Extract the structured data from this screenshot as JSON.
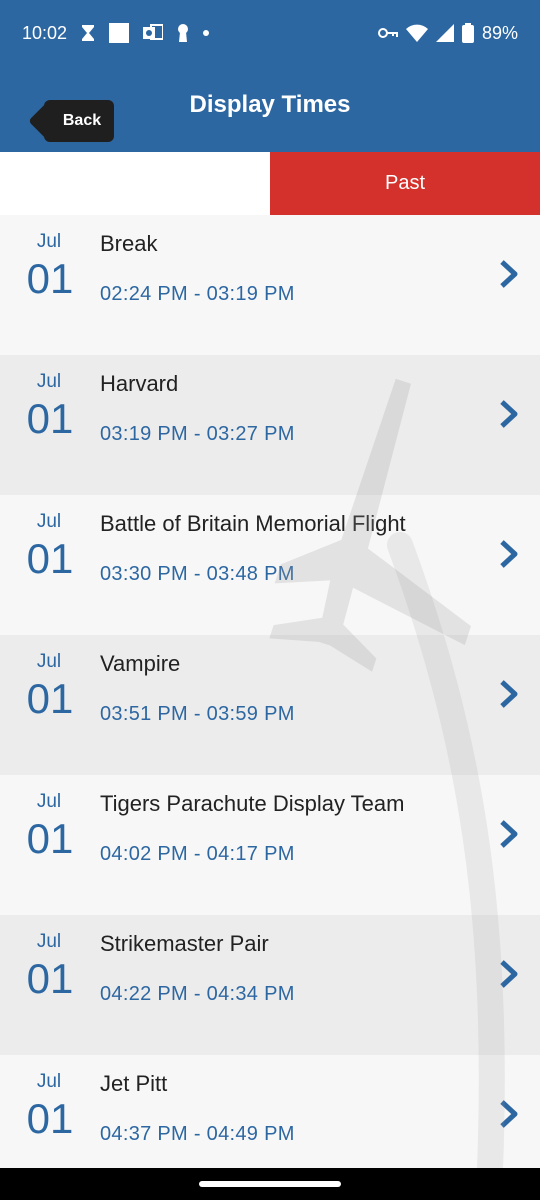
{
  "status_bar": {
    "time": "10:02",
    "battery": "89%",
    "icons": [
      "hourglass-icon",
      "square-icon",
      "outlook-icon",
      "keyhole-icon",
      "dot-icon",
      "vpn-key-icon",
      "wifi-icon",
      "signal-icon",
      "battery-icon"
    ]
  },
  "header": {
    "back_label": "Back",
    "title": "Display Times"
  },
  "tabs": {
    "past_label": "Past"
  },
  "colors": {
    "primary": "#2d67a2",
    "active_tab": "#d4302c",
    "row_light": "#f7f7f7",
    "row_dark": "#ececec"
  },
  "items": [
    {
      "month": "Jul",
      "day": "01",
      "title": "Break",
      "time": "02:24 PM - 03:19 PM"
    },
    {
      "month": "Jul",
      "day": "01",
      "title": "Harvard",
      "time": "03:19 PM - 03:27 PM"
    },
    {
      "month": "Jul",
      "day": "01",
      "title": "Battle of Britain Memorial Flight",
      "time": "03:30 PM - 03:48 PM"
    },
    {
      "month": "Jul",
      "day": "01",
      "title": "Vampire",
      "time": "03:51 PM - 03:59 PM"
    },
    {
      "month": "Jul",
      "day": "01",
      "title": "Tigers Parachute Display Team",
      "time": "04:02 PM - 04:17 PM"
    },
    {
      "month": "Jul",
      "day": "01",
      "title": "Strikemaster Pair",
      "time": "04:22 PM - 04:34 PM"
    },
    {
      "month": "Jul",
      "day": "01",
      "title": "Jet Pitt",
      "time": "04:37 PM - 04:49 PM"
    }
  ]
}
